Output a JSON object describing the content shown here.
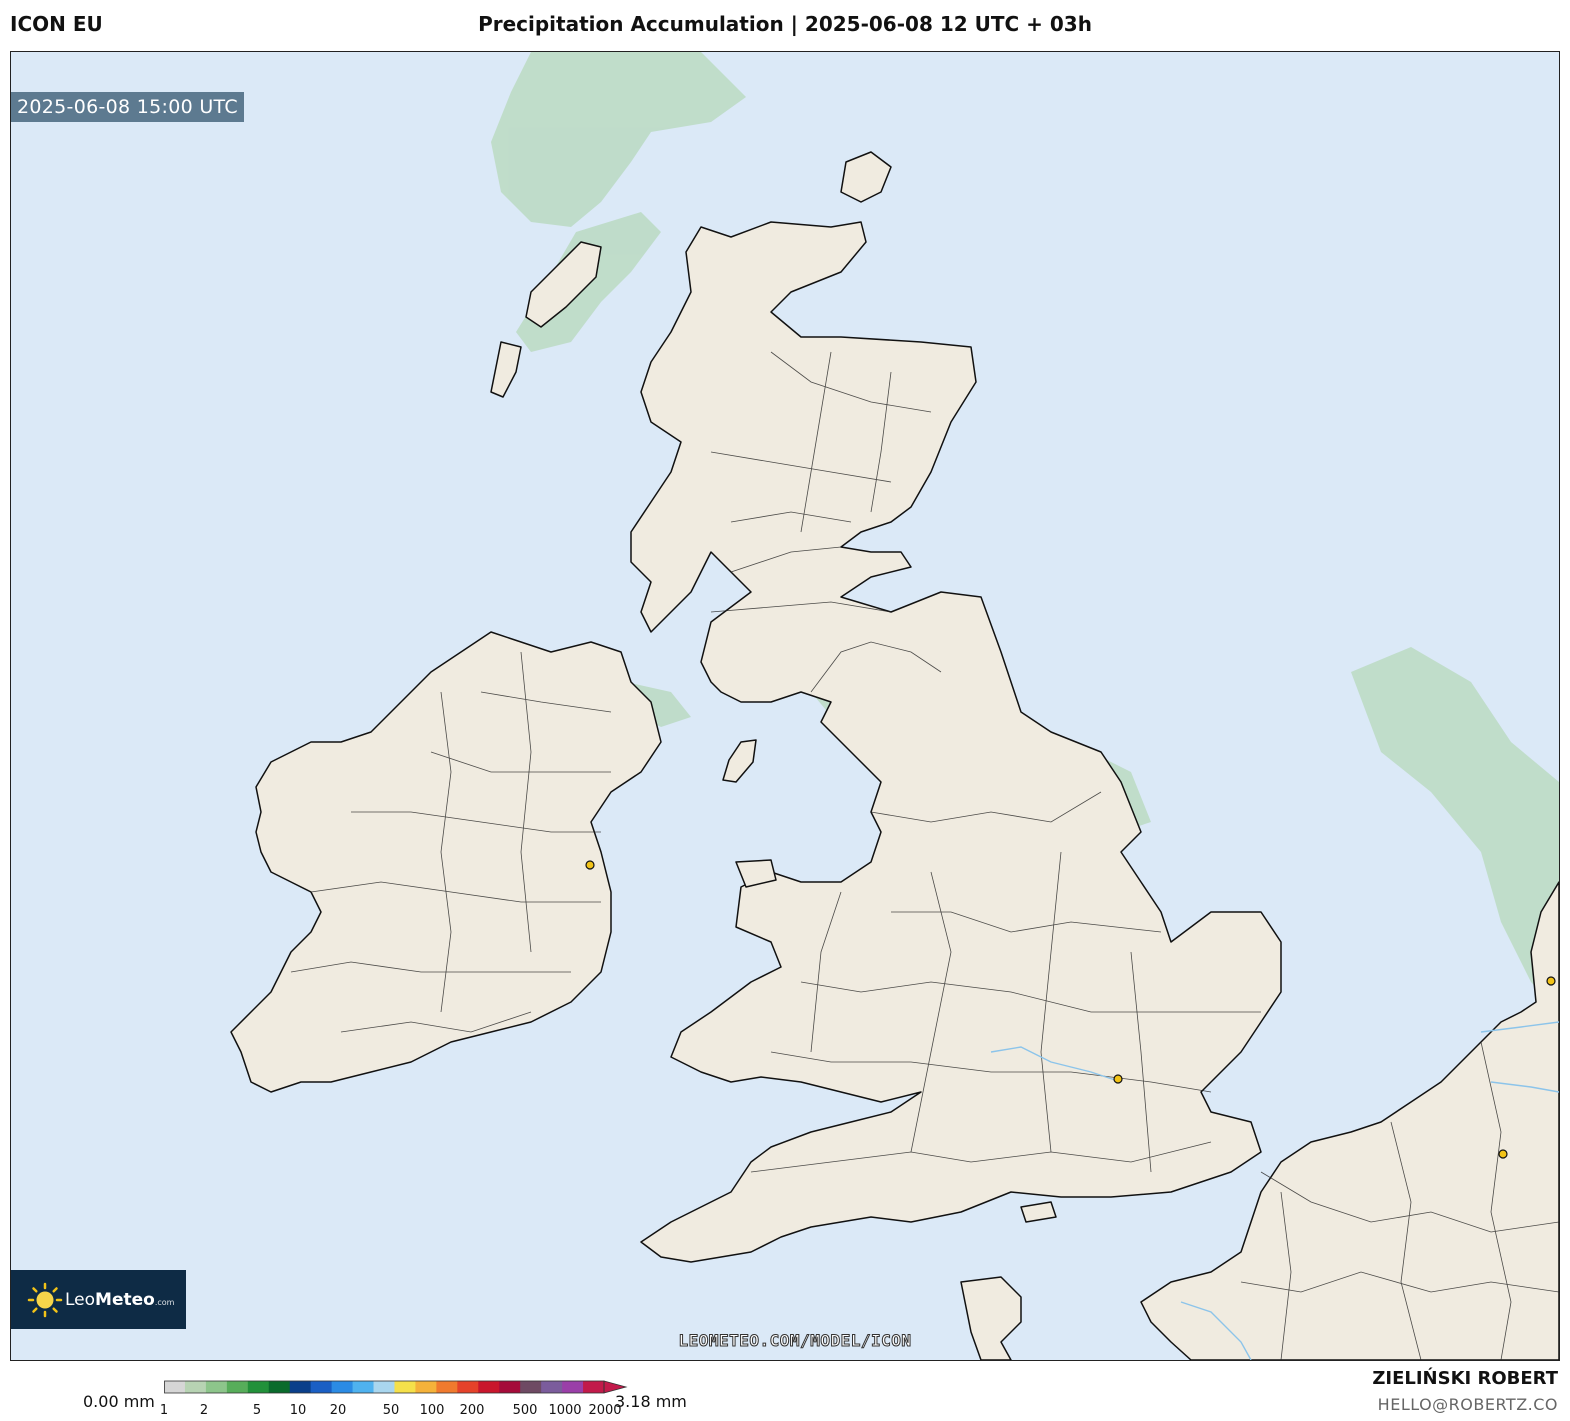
{
  "header": {
    "model": "ICON EU",
    "title": "Precipitation Accumulation | 2025-06-08 12 UTC + 03h"
  },
  "map": {
    "valid_time": "2025-06-08 15:00 UTC",
    "watermark": "LEOMETEO.COM/MODEL/ICON",
    "colors": {
      "sea": "#dbe9f7",
      "land": "#f0ebe0",
      "border": "#111111",
      "light_rain": "#a9d3a6",
      "moderate_rain": "#6ec6f0",
      "city": "#f2c318"
    }
  },
  "logo": {
    "brand_light": "Leo",
    "brand_bold": "Meteo",
    "brand_suffix": ".com"
  },
  "colorbar": {
    "min_label": "0.00 mm",
    "max_label": "3.18 mm",
    "ticks": [
      "1",
      "2",
      "5",
      "10",
      "20",
      "50",
      "100",
      "200",
      "500",
      "1000",
      "2000"
    ],
    "colors": [
      "#d6d6d6",
      "#b7d3b3",
      "#8dc58b",
      "#57ad5a",
      "#22913a",
      "#0a6b2c",
      "#0a3f8a",
      "#1a5fc4",
      "#2b8be4",
      "#4fb2ef",
      "#a9d6ee",
      "#f5e04a",
      "#f5b23a",
      "#f07a2e",
      "#e5422a",
      "#c9162c",
      "#a50b3a",
      "#6e4a63",
      "#7b5c9c",
      "#9a3fa8",
      "#c21a4a"
    ]
  },
  "credits": {
    "author": "ZIELIŃSKI ROBERT",
    "email": "HELLO@ROBERTZ.CO"
  }
}
